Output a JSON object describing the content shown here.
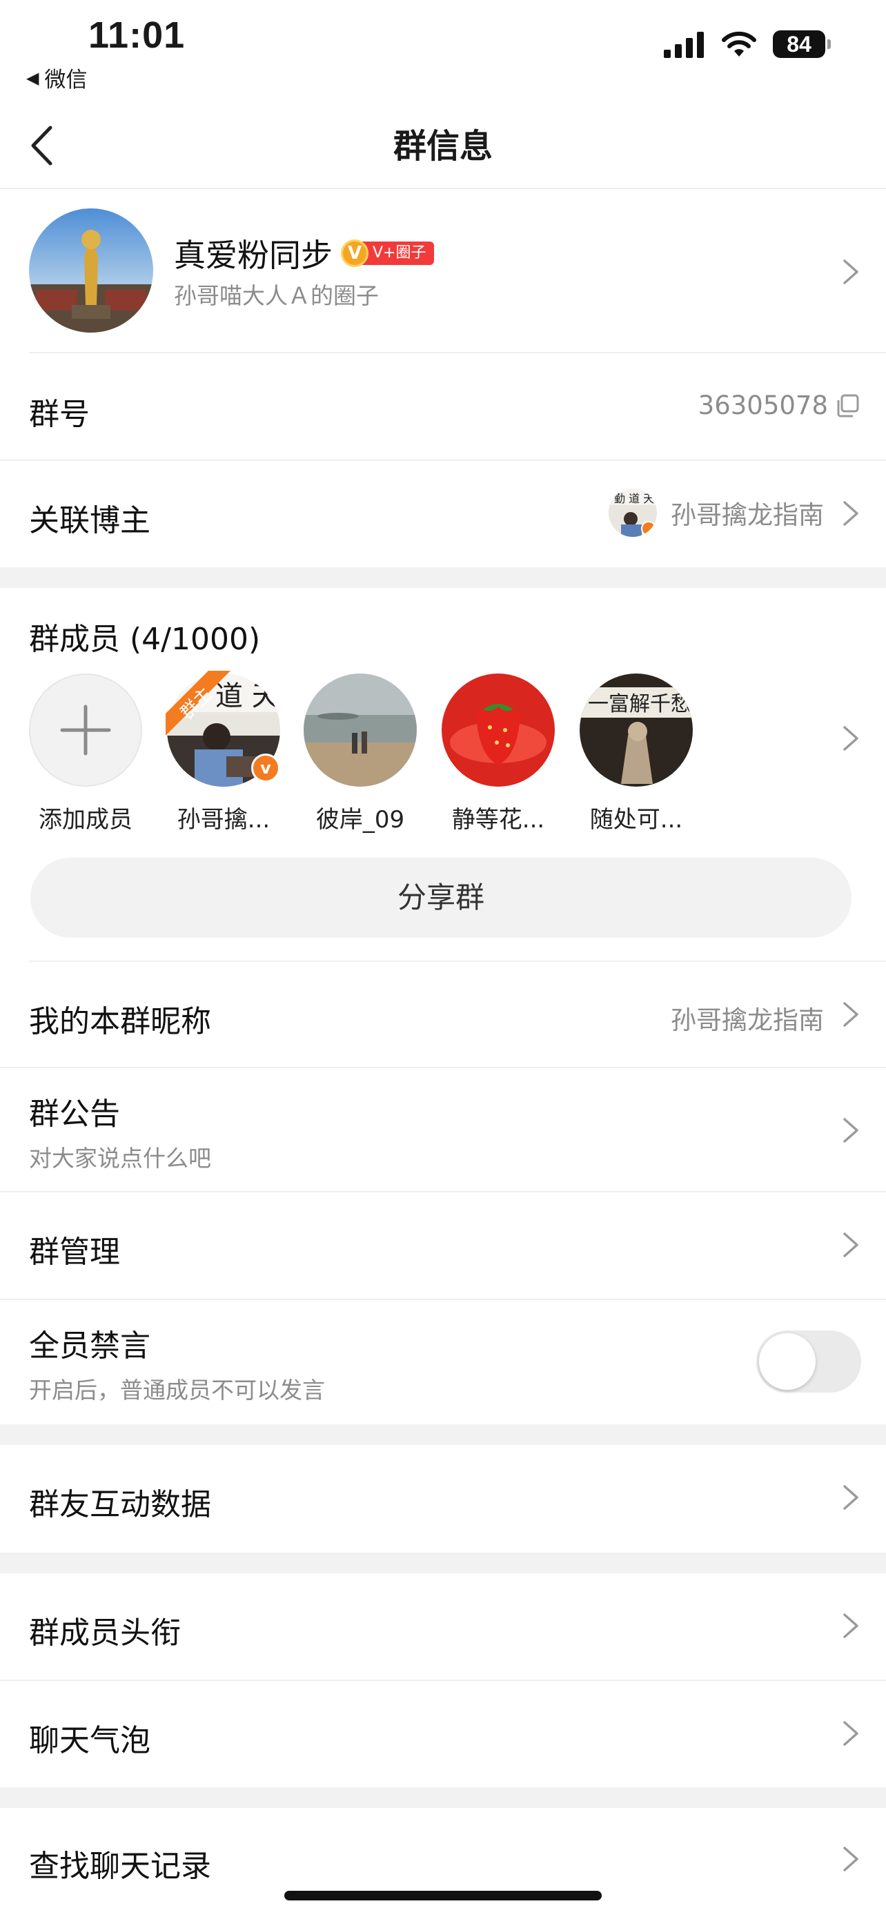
{
  "status_bar": {
    "time": "11:01",
    "back_app": "微信",
    "battery": "84",
    "icons": [
      "signal-icon",
      "wifi-icon",
      "battery-icon"
    ]
  },
  "nav": {
    "title": "群信息",
    "back_icon": "chevron-left-icon"
  },
  "group": {
    "name": "真爱粉同步",
    "badge_v": "V",
    "badge_label": "V+圈子",
    "subtitle": "孙哥喵大人Ａ的圈子"
  },
  "rows": {
    "group_id_label": "群号",
    "group_id_value": "36305078",
    "blogger_label": "关联博主",
    "blogger_value": "孙哥擒龙指南"
  },
  "members": {
    "title": "群成员 (4/1000)",
    "add_label": "添加成员",
    "owner_tag": "群主",
    "list": [
      {
        "name": "孙哥擒..."
      },
      {
        "name": "彼岸_09"
      },
      {
        "name": "静等花..."
      },
      {
        "name": "随处可..."
      }
    ],
    "share_label": "分享群"
  },
  "settings": {
    "nickname_label": "我的本群昵称",
    "nickname_value": "孙哥擒龙指南",
    "notice_label": "群公告",
    "notice_sub": "对大家说点什么吧",
    "manage_label": "群管理",
    "mute_label": "全员禁言",
    "mute_sub": "开启后，普通成员不可以发言",
    "mute_on": false,
    "interaction_label": "群友互动数据",
    "titles_label": "群成员头衔",
    "bubble_label": "聊天气泡",
    "search_label": "查找聊天记录"
  },
  "colors": {
    "accent": "#f47b20",
    "badge_red": "#f13b3b",
    "badge_gold": "#f6a623",
    "secondary_text": "#8c8c8c",
    "separator": "#f2f2f2"
  }
}
